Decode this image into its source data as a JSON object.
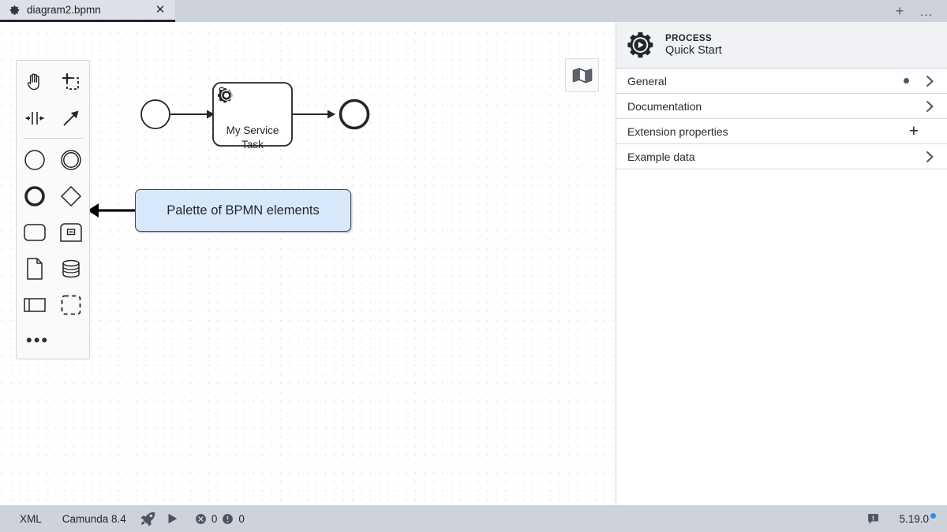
{
  "tabbar": {
    "tab": {
      "title": "diagram2.bpmn",
      "icon": "gear-icon",
      "close_label": "✕"
    },
    "new_tab_label": "+",
    "overflow_label": "…"
  },
  "canvas": {
    "minimap_icon": "map-icon",
    "palette": {
      "tools": [
        {
          "name": "hand-tool",
          "icon": "hand-icon"
        },
        {
          "name": "lasso-tool",
          "icon": "lasso-icon"
        },
        {
          "name": "space-tool",
          "icon": "space-tool-icon"
        },
        {
          "name": "connect-tool",
          "icon": "arrow-icon"
        }
      ],
      "elements": [
        {
          "name": "create-start-event",
          "icon": "circle-thin-icon"
        },
        {
          "name": "create-intermediate-event",
          "icon": "double-circle-icon"
        },
        {
          "name": "create-end-event",
          "icon": "circle-thick-icon"
        },
        {
          "name": "create-gateway",
          "icon": "diamond-icon"
        },
        {
          "name": "create-task",
          "icon": "rounded-rect-icon"
        },
        {
          "name": "create-subprocess",
          "icon": "subprocess-icon"
        },
        {
          "name": "create-data-object",
          "icon": "document-icon"
        },
        {
          "name": "create-data-store",
          "icon": "database-icon"
        },
        {
          "name": "create-participant",
          "icon": "pool-icon"
        },
        {
          "name": "create-group",
          "icon": "dashed-rect-icon"
        }
      ],
      "more_label": "•••"
    },
    "diagram": {
      "start_event": {
        "name": "StartEvent"
      },
      "service_task": {
        "label_line1": "My Service",
        "label_line2": "Task",
        "icon": "gears-icon"
      },
      "end_event": {
        "name": "EndEvent"
      }
    },
    "callout": {
      "text": "Palette of BPMN elements",
      "fill": "#d7e8fa",
      "stroke": "#41464e"
    }
  },
  "properties": {
    "header": {
      "kind": "PROCESS",
      "name": "Quick Start",
      "icon": "process-gear-play-icon"
    },
    "groups": [
      {
        "label": "General",
        "has_dot": true,
        "action": "chevron"
      },
      {
        "label": "Documentation",
        "has_dot": false,
        "action": "chevron"
      },
      {
        "label": "Extension properties",
        "has_dot": false,
        "action": "plus"
      },
      {
        "label": "Example data",
        "has_dot": false,
        "action": "chevron"
      }
    ]
  },
  "statusbar": {
    "xml_label": "XML",
    "engine_label": "Camunda 8.4",
    "deploy_icon": "rocket-icon",
    "run_icon": "play-icon",
    "error_count": "0",
    "warning_count": "0",
    "feedback_icon": "feedback-icon",
    "version": "5.19.0",
    "update_dot_color": "#2b8df5"
  }
}
